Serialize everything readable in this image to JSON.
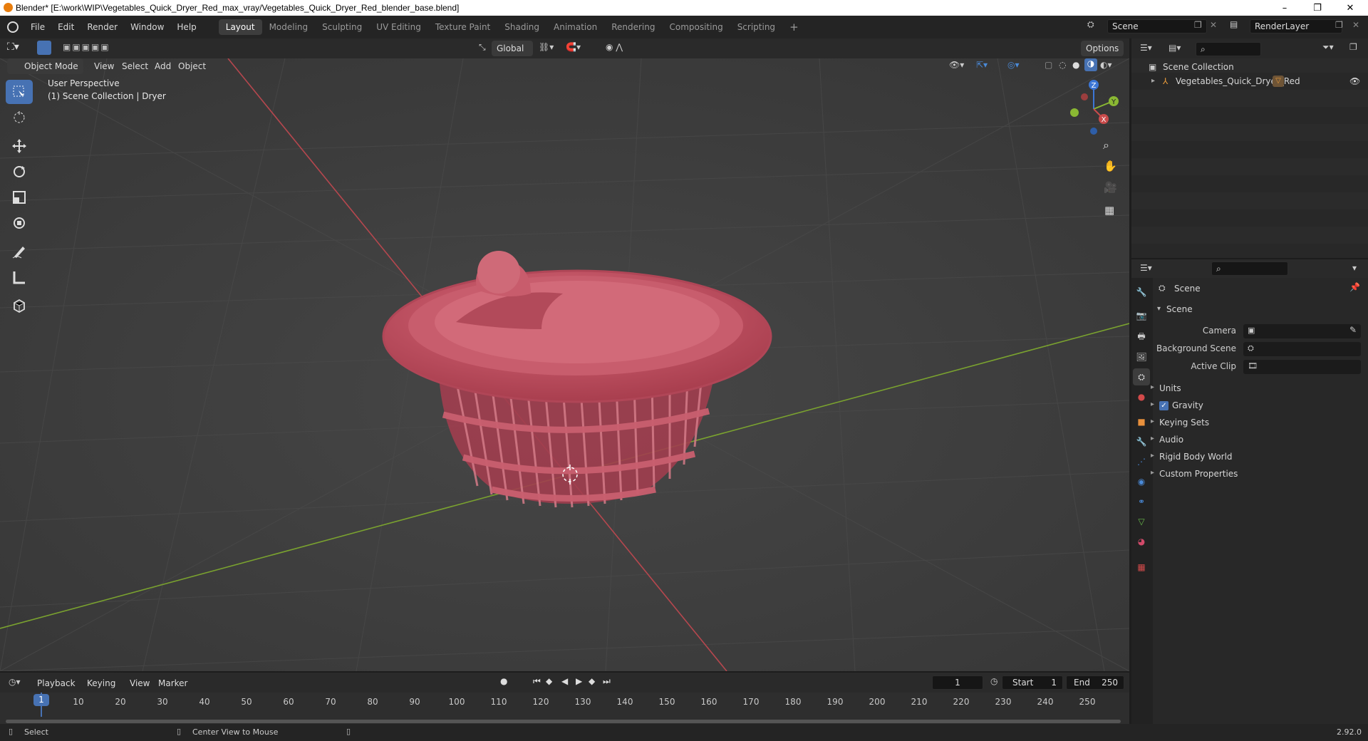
{
  "window": {
    "title": "Blender* [E:\\work\\WIP\\Vegetables_Quick_Dryer_Red_max_vray/Vegetables_Quick_Dryer_Red_blender_base.blend]",
    "minimize": "–",
    "maximize": "❐",
    "close": "✕"
  },
  "menu": [
    "File",
    "Edit",
    "Render",
    "Window",
    "Help"
  ],
  "workspaces": [
    "Layout",
    "Modeling",
    "Sculpting",
    "UV Editing",
    "Texture Paint",
    "Shading",
    "Animation",
    "Rendering",
    "Compositing",
    "Scripting"
  ],
  "workspace_add": "+",
  "scene_field": "Scene",
  "renderlayer_field": "RenderLayer",
  "viewport_header": {
    "mode": "Object Mode",
    "menus": [
      "View",
      "Select",
      "Add",
      "Object"
    ],
    "orientation": "Global",
    "options": "Options"
  },
  "viewport": {
    "perspective": "User Perspective",
    "collection": "(1) Scene Collection | Dryer",
    "gizmo_axes": {
      "z": "Z",
      "y": "Y",
      "x": "X"
    }
  },
  "outliner": {
    "root": "Scene Collection",
    "items": [
      "Vegetables_Quick_Dryer_Red"
    ]
  },
  "properties": {
    "header": "Scene",
    "section": "Scene",
    "fields": {
      "camera_label": "Camera",
      "background_label": "Background Scene",
      "clip_label": "Active Clip"
    },
    "panels": [
      "Units",
      "Gravity",
      "Keying Sets",
      "Audio",
      "Rigid Body World",
      "Custom Properties"
    ],
    "gravity_checked": true
  },
  "timeline": {
    "menus": [
      "Playback",
      "Keying",
      "View",
      "Marker"
    ],
    "current_frame": "1",
    "start_label": "Start",
    "start_value": "1",
    "end_label": "End",
    "end_value": "250",
    "ticks": [
      "10",
      "20",
      "30",
      "40",
      "50",
      "60",
      "70",
      "80",
      "90",
      "100",
      "110",
      "120",
      "130",
      "140",
      "150",
      "160",
      "170",
      "180",
      "190",
      "200",
      "210",
      "220",
      "230",
      "240",
      "250"
    ]
  },
  "statusbar": {
    "left": "Select",
    "middle": "Center View to Mouse",
    "version": "2.92.0"
  },
  "colors": {
    "accent": "#4772b3",
    "object": "#b84a58",
    "x_axis": "#c94b4b",
    "y_axis": "#8ab833"
  }
}
